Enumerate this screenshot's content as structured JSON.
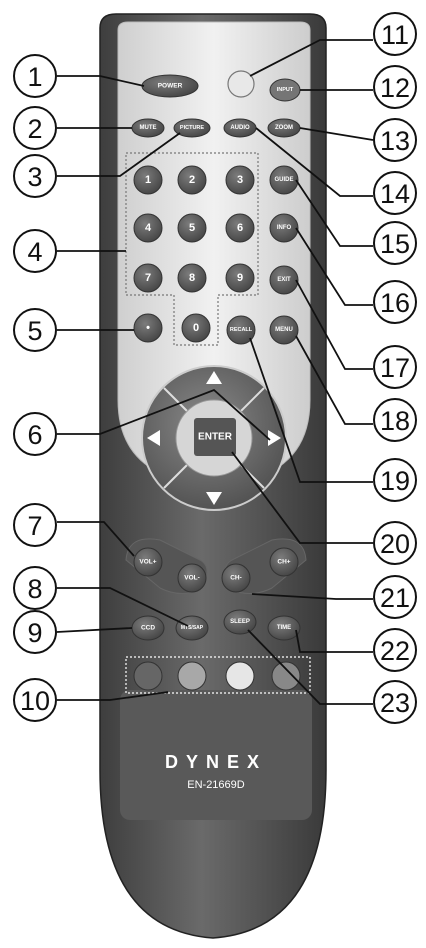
{
  "brand": "DYNEX",
  "model": "EN-21669D",
  "buttons": {
    "power": "POWER",
    "input": "INPUT",
    "mute": "MUTE",
    "picture": "PICTURE",
    "audio": "AUDIO",
    "zoom": "ZOOM",
    "guide": "GUIDE",
    "info": "INFO",
    "exit": "EXIT",
    "recall": "RECALL",
    "menu": "MENU",
    "enter": "ENTER",
    "vol_up": "VOL+",
    "vol_down": "VOL-",
    "ch_down": "CH-",
    "ch_up": "CH+",
    "mts": "MTS/SAP",
    "ccd": "CCD",
    "sleep": "SLEEP",
    "time": "TIME",
    "dot": "•",
    "digits": [
      "1",
      "2",
      "3",
      "4",
      "5",
      "6",
      "7",
      "8",
      "9",
      "0"
    ]
  },
  "callouts": [
    "1",
    "2",
    "3",
    "4",
    "5",
    "6",
    "7",
    "8",
    "9",
    "10",
    "11",
    "12",
    "13",
    "14",
    "15",
    "16",
    "17",
    "18",
    "19",
    "20",
    "21",
    "22",
    "23"
  ],
  "colors": {
    "body_dark": "#4a4a4a",
    "faceplate": "#e2e2e2",
    "button": "#555555",
    "input_button": "#757575",
    "blank_button": "#e8e8e8",
    "color_keys": [
      "#666666",
      "#a8a8a8",
      "#e6e6e6",
      "#888888"
    ]
  }
}
